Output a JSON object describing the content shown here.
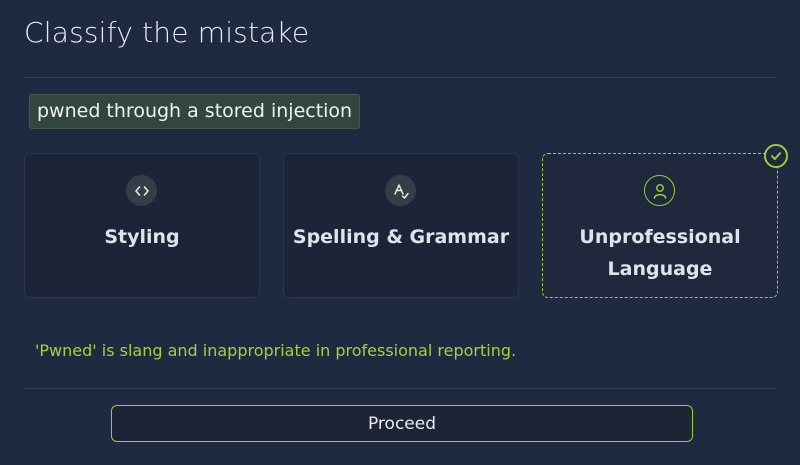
{
  "header": {
    "title": "Classify the mistake"
  },
  "phrase": "pwned through a stored injection",
  "options": [
    {
      "label": "Styling",
      "icon": "code-icon",
      "selected": false
    },
    {
      "label": "Spelling & Grammar",
      "icon": "spell-check-icon",
      "selected": false
    },
    {
      "label": "Unprofessional\nLanguage",
      "icon": "user-icon",
      "selected": true
    }
  ],
  "feedback": "'Pwned' is slang and inappropriate in professional reporting.",
  "actions": {
    "proceed_label": "Proceed"
  },
  "colors": {
    "background": "#1f2940",
    "accent": "#9ccc3c",
    "feedback": "#a6d13a"
  }
}
